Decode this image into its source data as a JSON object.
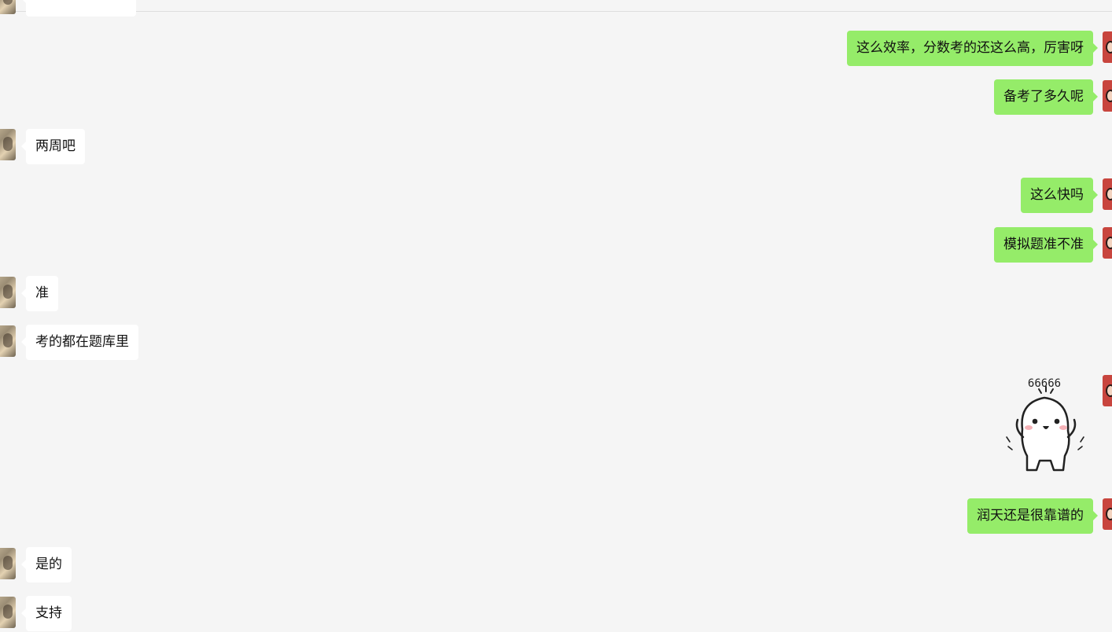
{
  "messages": [
    {
      "side": "left",
      "text": ""
    },
    {
      "side": "right",
      "text": "这么效率，分数考的还这么高，厉害呀"
    },
    {
      "side": "right",
      "text": "备考了多久呢"
    },
    {
      "side": "left",
      "text": "两周吧"
    },
    {
      "side": "right",
      "text": "这么快吗"
    },
    {
      "side": "right",
      "text": "模拟题准不准"
    },
    {
      "side": "left",
      "text": "准"
    },
    {
      "side": "left",
      "text": "考的都在题库里"
    },
    {
      "side": "right",
      "type": "sticker",
      "caption": "66666"
    },
    {
      "side": "right",
      "text": "润天还是很靠谱的"
    },
    {
      "side": "left",
      "text": "是的"
    },
    {
      "side": "left",
      "text": "支持"
    }
  ],
  "colors": {
    "background": "#f5f5f5",
    "incoming_bubble": "#ffffff",
    "outgoing_bubble": "#95ec69",
    "text": "#111111"
  },
  "icons": {
    "incoming_avatar": "contact-avatar",
    "outgoing_avatar": "self-avatar",
    "sticker": "cartoon-66666-sticker"
  }
}
